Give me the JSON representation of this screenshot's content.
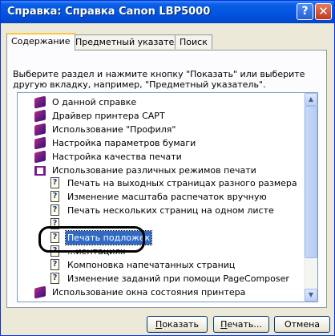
{
  "window": {
    "title": "Справка: Справка Canon LBP5000",
    "help_button": "?",
    "close_button": "✕"
  },
  "tabs": [
    {
      "label": "Содержание",
      "active": true
    },
    {
      "label": "Предметный указатель",
      "active": false
    },
    {
      "label": "Поиск",
      "active": false
    }
  ],
  "instruction": "Выберите раздел и нажмите кнопку \"Показать\" или выберите другую вкладку, например, \"Предметный указатель\".",
  "tree": {
    "items": [
      {
        "label": "О данной справке",
        "icon": "book-icon"
      },
      {
        "label": "Драйвер принтера CAPT",
        "icon": "book-icon"
      },
      {
        "label": "Использование \"Профиля\"",
        "icon": "book-icon"
      },
      {
        "label": "Настройка параметров бумаги",
        "icon": "book-icon"
      },
      {
        "label": "Настройка качества печати",
        "icon": "book-icon"
      },
      {
        "label": "Использование различных режимов печати",
        "icon": "open-book-icon"
      },
      {
        "label": "Печать на выходных страницах разного размера",
        "icon": "help-page-icon"
      },
      {
        "label": "Изменение масштаба распечаток вручную",
        "icon": "help-page-icon"
      },
      {
        "label": "Печать нескольких страниц на одном листе",
        "icon": "help-page-icon"
      },
      {
        "label": "",
        "icon": "help-page-icon"
      },
      {
        "label": "Печать подложек",
        "icon": "help-page-icon",
        "selected": true
      },
      {
        "label": "...иентациях",
        "icon": "help-page-icon"
      },
      {
        "label": "Компоновка напечатанных страниц",
        "icon": "help-page-icon"
      },
      {
        "label": "Изменение заданий при помощи PageComposer",
        "icon": "help-page-icon"
      },
      {
        "label": "Использование окна состояния принтера",
        "icon": "book-icon"
      }
    ]
  },
  "buttons": {
    "show_prefix": "П",
    "show_rest": "оказать",
    "print_prefix": "П",
    "print_rest": "ечать...",
    "cancel": "Отмена"
  },
  "colors": {
    "selection": "#316ac5",
    "titlebar": "#0254e0"
  }
}
